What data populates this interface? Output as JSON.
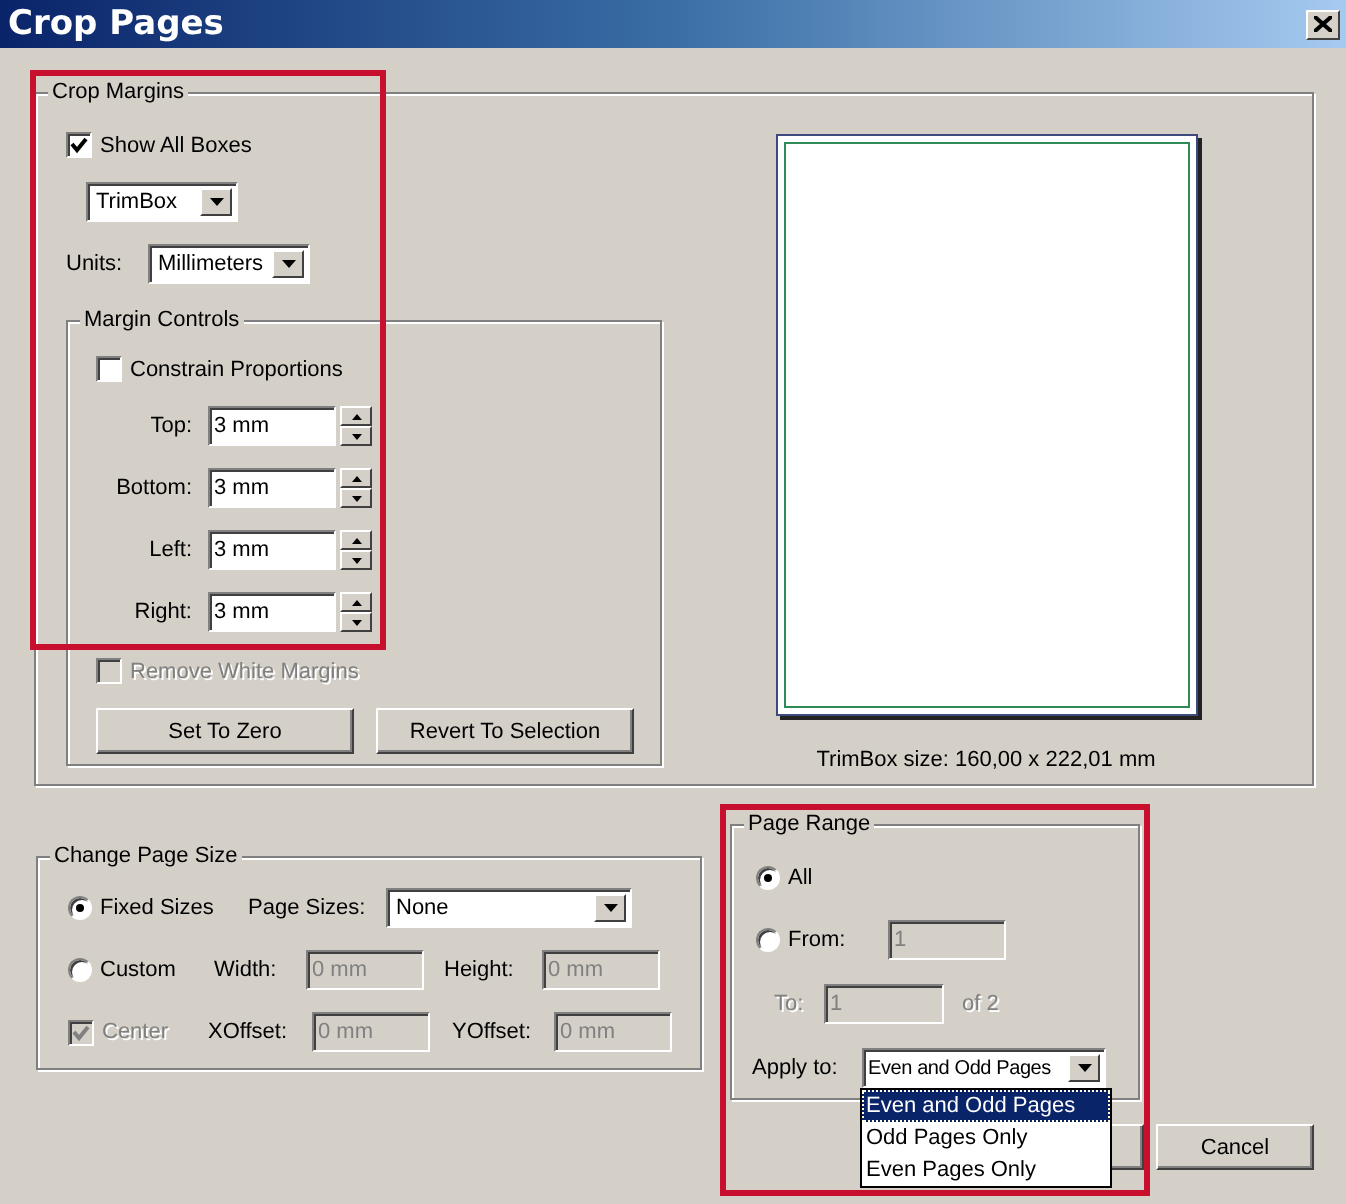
{
  "window": {
    "title": "Crop Pages"
  },
  "crop_margins": {
    "title": "Crop Margins",
    "show_all_boxes": {
      "label": "Show All Boxes",
      "checked": true
    },
    "box_type": {
      "value": "TrimBox"
    },
    "units": {
      "label": "Units:",
      "value": "Millimeters"
    },
    "margin_controls": {
      "title": "Margin Controls",
      "constrain_proportions": {
        "label": "Constrain Proportions",
        "checked": false
      },
      "margins": [
        {
          "label": "Top:",
          "value": "3 mm"
        },
        {
          "label": "Bottom:",
          "value": "3 mm"
        },
        {
          "label": "Left:",
          "value": "3 mm"
        },
        {
          "label": "Right:",
          "value": "3 mm"
        }
      ],
      "remove_white_margins": {
        "label": "Remove White Margins",
        "checked": false,
        "disabled": true
      },
      "buttons": [
        "Set To Zero",
        "Revert To Selection"
      ]
    },
    "preview": {
      "caption": "TrimBox size: 160,00 x 222,01 mm"
    }
  },
  "change_page_size": {
    "title": "Change Page Size",
    "modes": [
      {
        "label": "Fixed Sizes",
        "selected": true
      },
      {
        "label": "Custom",
        "selected": false
      }
    ],
    "page_sizes": {
      "label": "Page Sizes:",
      "value": "None"
    },
    "width": {
      "label": "Width:",
      "value": "0 mm",
      "disabled": true
    },
    "height": {
      "label": "Height:",
      "value": "0 mm",
      "disabled": true
    },
    "center": {
      "label": "Center",
      "checked": true,
      "disabled": true
    },
    "xoffset": {
      "label": "XOffset:",
      "value": "0 mm",
      "disabled": true
    },
    "yoffset": {
      "label": "YOffset:",
      "value": "0 mm",
      "disabled": true
    }
  },
  "page_range": {
    "title": "Page Range",
    "modes": [
      {
        "label": "All",
        "selected": true
      },
      {
        "label": "From:",
        "selected": false
      }
    ],
    "from": {
      "value": "1",
      "disabled": true
    },
    "to": {
      "label": "To:",
      "value": "1",
      "disabled": true
    },
    "total": {
      "label": "of 2",
      "disabled": true
    },
    "apply_to": {
      "label": "Apply to:",
      "value": "Even and Odd Pages",
      "expanded": true,
      "options": [
        {
          "label": "Even and Odd Pages",
          "selected": true
        },
        {
          "label": "Odd Pages Only",
          "selected": false
        },
        {
          "label": "Even Pages Only",
          "selected": false
        }
      ]
    }
  },
  "buttons": [
    "Cancel"
  ]
}
